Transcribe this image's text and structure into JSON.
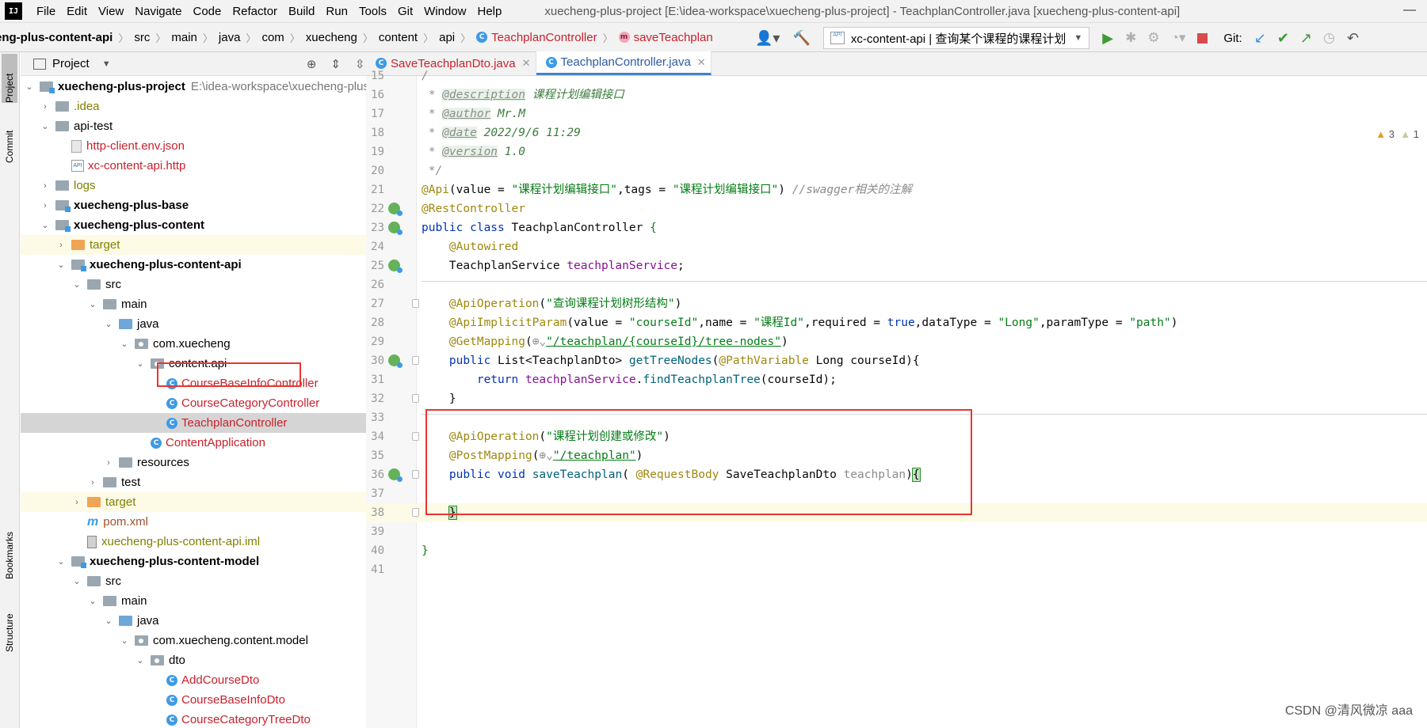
{
  "menu": {
    "items": [
      "File",
      "Edit",
      "View",
      "Navigate",
      "Code",
      "Refactor",
      "Build",
      "Run",
      "Tools",
      "Git",
      "Window",
      "Help"
    ],
    "window_title": "xuecheng-plus-project [E:\\idea-workspace\\xuecheng-plus-project] - TeachplanController.java [xuecheng-plus-content-api]"
  },
  "breadcrumb": {
    "items": [
      "eng-plus-content-api",
      "src",
      "main",
      "java",
      "com",
      "xuecheng",
      "content",
      "api",
      "TeachplanController",
      "saveTeachplan"
    ]
  },
  "toolbar": {
    "run_config": "xc-content-api | 查询某个课程的课程计划",
    "git_label": "Git:"
  },
  "sidebar": {
    "tabs": [
      "Project",
      "Commit",
      "Bookmarks",
      "Structure"
    ]
  },
  "project_panel": {
    "title": "Project",
    "tree": [
      {
        "label": "xuecheng-plus-project",
        "extra": "E:\\idea-workspace\\xuecheng-plus-pr"
      },
      {
        "label": ".idea"
      },
      {
        "label": "api-test"
      },
      {
        "label": "http-client.env.json"
      },
      {
        "label": "xc-content-api.http"
      },
      {
        "label": "logs"
      },
      {
        "label": "xuecheng-plus-base"
      },
      {
        "label": "xuecheng-plus-content"
      },
      {
        "label": "target"
      },
      {
        "label": "xuecheng-plus-content-api"
      },
      {
        "label": "src"
      },
      {
        "label": "main"
      },
      {
        "label": "java"
      },
      {
        "label": "com.xuecheng"
      },
      {
        "label": "content.api"
      },
      {
        "label": "CourseBaseInfoController"
      },
      {
        "label": "CourseCategoryController"
      },
      {
        "label": "TeachplanController"
      },
      {
        "label": "ContentApplication"
      },
      {
        "label": "resources"
      },
      {
        "label": "test"
      },
      {
        "label": "target"
      },
      {
        "label": "pom.xml"
      },
      {
        "label": "xuecheng-plus-content-api.iml"
      },
      {
        "label": "xuecheng-plus-content-model"
      },
      {
        "label": "src"
      },
      {
        "label": "main"
      },
      {
        "label": "java"
      },
      {
        "label": "com.xuecheng.content.model"
      },
      {
        "label": "dto"
      },
      {
        "label": "AddCourseDto"
      },
      {
        "label": "CourseBaseInfoDto"
      },
      {
        "label": "CourseCategoryTreeDto"
      }
    ]
  },
  "editor": {
    "tabs": [
      {
        "label": "SaveTeachplanDto.java"
      },
      {
        "label": "TeachplanController.java"
      }
    ],
    "warnings": {
      "warn_count": "3",
      "weak_count": "1"
    },
    "lines": {
      "l15": "15",
      "l16": "16",
      "l16_tag": "@description",
      "l16_val": "课程计划编辑接口",
      "l17": "17",
      "l17_tag": "@author",
      "l17_val": "Mr.M",
      "l18": "18",
      "l18_tag": "@date",
      "l18_val": "2022/9/6 11:29",
      "l19": "19",
      "l19_tag": "@version",
      "l19_val": "1.0",
      "l20": "20",
      "l21": "21",
      "l21_str1": "\"课程计划编辑接口\"",
      "l21_str2": "\"课程计划编辑接口\"",
      "l21_cm": "//swagger相关的注解",
      "l22": "22",
      "l23": "23",
      "l24": "24",
      "l25": "25",
      "l26": "26",
      "l27": "27",
      "l27_str": "\"查询课程计划树形结构\"",
      "l28": "28",
      "l29": "29",
      "l29_str": "\"/teachplan/{courseId}/tree-nodes\"",
      "l30": "30",
      "l31": "31",
      "l32": "32",
      "l33": "33",
      "l34": "34",
      "l34_str": "\"课程计划创建或修改\"",
      "l35": "35",
      "l35_str": "\"/teachplan\"",
      "l36": "36",
      "l37": "37",
      "l38": "38",
      "l39": "39",
      "l40": "40",
      "l41": "41"
    }
  },
  "watermark": "CSDN @清风微凉 aaa"
}
